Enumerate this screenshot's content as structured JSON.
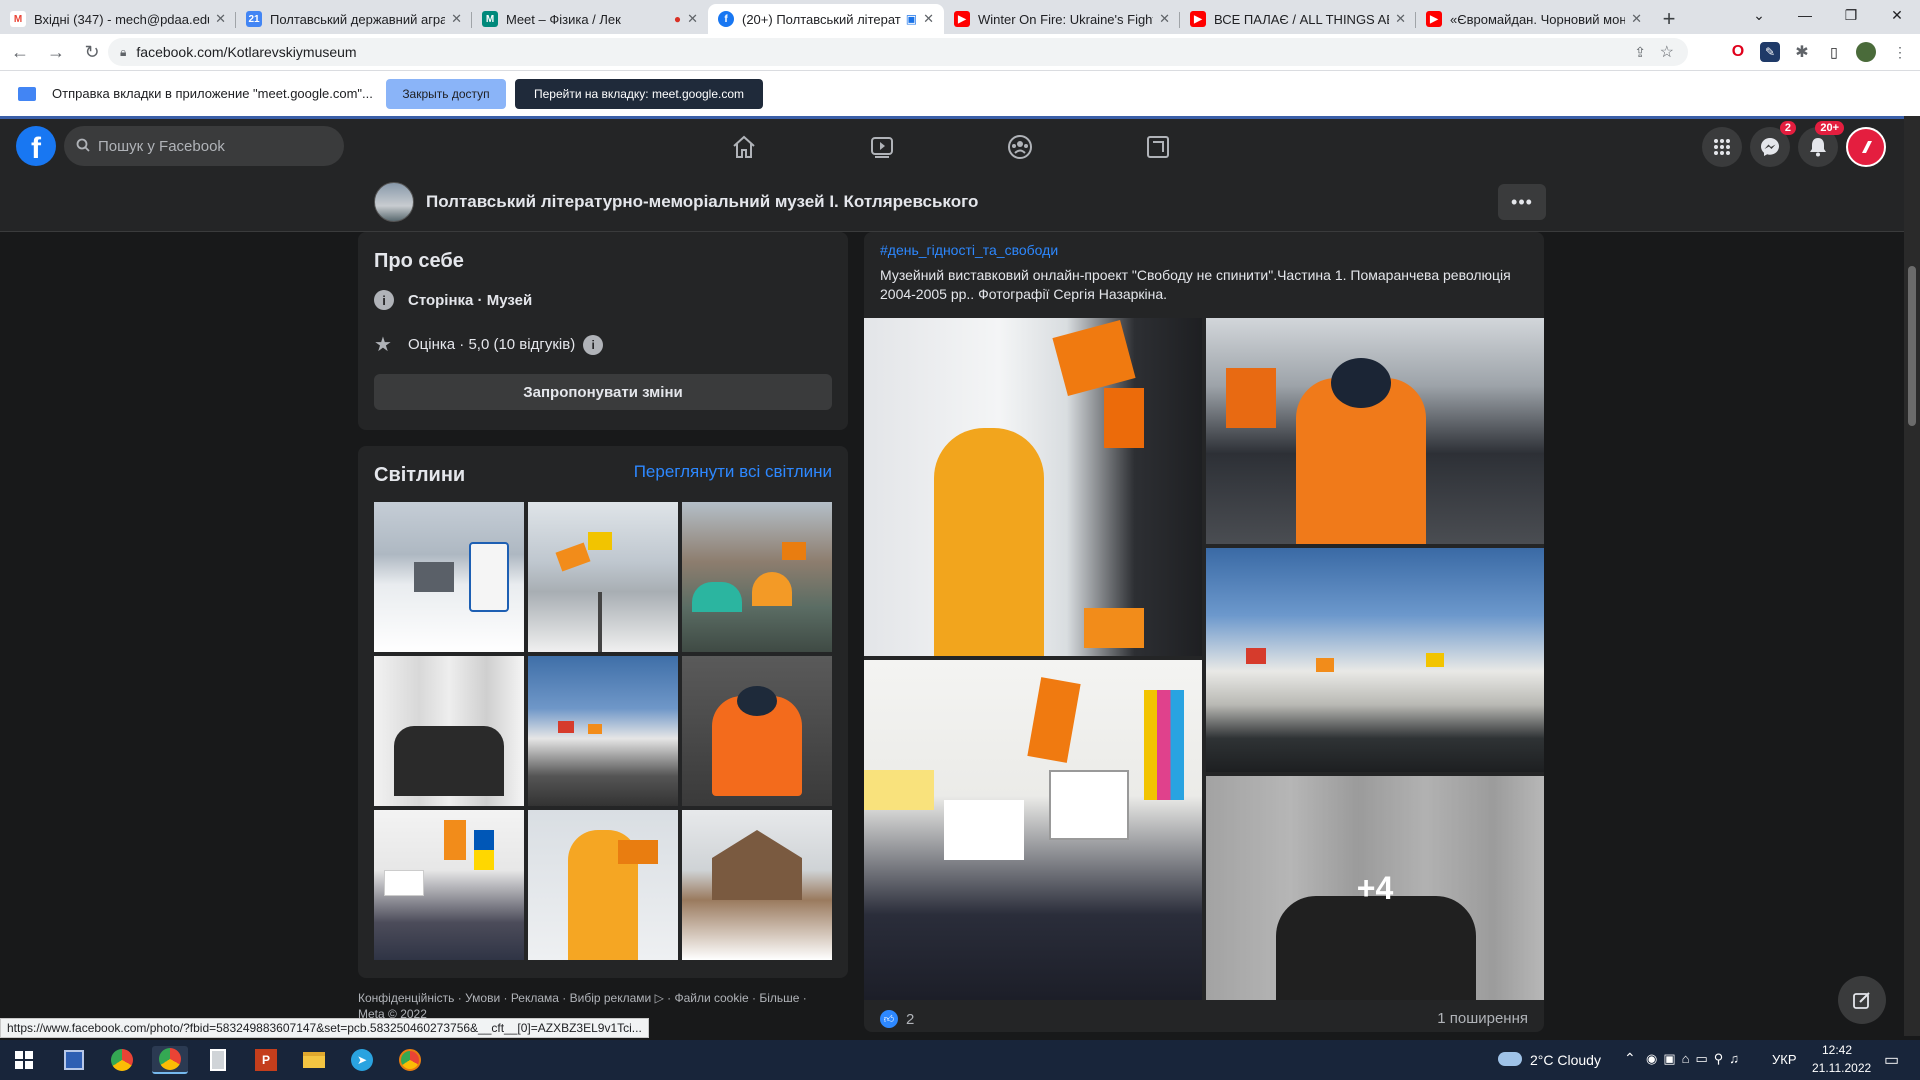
{
  "browser": {
    "tabs": [
      {
        "title": "Вхідні (347) - mech@pdaa.edu.",
        "favicon": "M",
        "color": "#ea4335"
      },
      {
        "title": "Полтавський державний аграр",
        "favicon": "21",
        "color": "#4285f4"
      },
      {
        "title": "Meet – Фізика / Лек",
        "favicon": "M",
        "color": "#00897b"
      },
      {
        "title": "(20+) Полтавський літерат",
        "favicon": "f",
        "color": "#1877f2"
      },
      {
        "title": "Winter On Fire: Ukraine's Fight f",
        "favicon": "▶",
        "color": "#ff0000"
      },
      {
        "title": "ВСЕ ПАЛАЄ / ALL THINGS ABLA",
        "favicon": "▶",
        "color": "#ff0000"
      },
      {
        "title": "«Євромайдан. Чорновий монт",
        "favicon": "▶",
        "color": "#ff0000"
      }
    ],
    "url": "facebook.com/Kotlarevskiymuseum",
    "infobar_text": "Отправка вкладки в приложение \"meet.google.com\"...",
    "infobar_close": "Закрыть доступ",
    "infobar_go": "Перейти на вкладку: meet.google.com",
    "status_url": "https://www.facebook.com/photo/?fbid=583249883607147&set=pcb.583250460273756&__cft__[0]=AZXBZ3EL9v1Tci..."
  },
  "fb": {
    "search_placeholder": "Пошук у Facebook",
    "messenger_badge": "2",
    "notif_badge": "20+",
    "page_name": "Полтавський літературно-меморіальний музей І. Котляревського"
  },
  "about": {
    "title": "Про себе",
    "category": "Сторінка · Музей",
    "rating": "Оцінка · 5,0 (10 відгуків)",
    "suggest": "Запропонувати зміни"
  },
  "photos": {
    "title": "Світлини",
    "see_all": "Переглянути всі світлини"
  },
  "footer": {
    "links": "Конфіденційність · Умови · Реклама · Вибір реклами ▷ · Файли cookie · Більше ·",
    "copyright": "Meta © 2022"
  },
  "post": {
    "hashtag": "#день_гідності_та_свободи",
    "text": "Музейний  виставковий онлайн-проект \"Свободу не спинити\".Частина 1. Помаранчева революція 2004-2005 рр.. Фотографії Сергія Назаркіна.",
    "more_count": "+4",
    "likes": "2",
    "shares": "1 поширення"
  },
  "taskbar": {
    "weather": "2°C  Cloudy",
    "lang": "УКР",
    "time": "12:42",
    "date": "21.11.2022"
  }
}
